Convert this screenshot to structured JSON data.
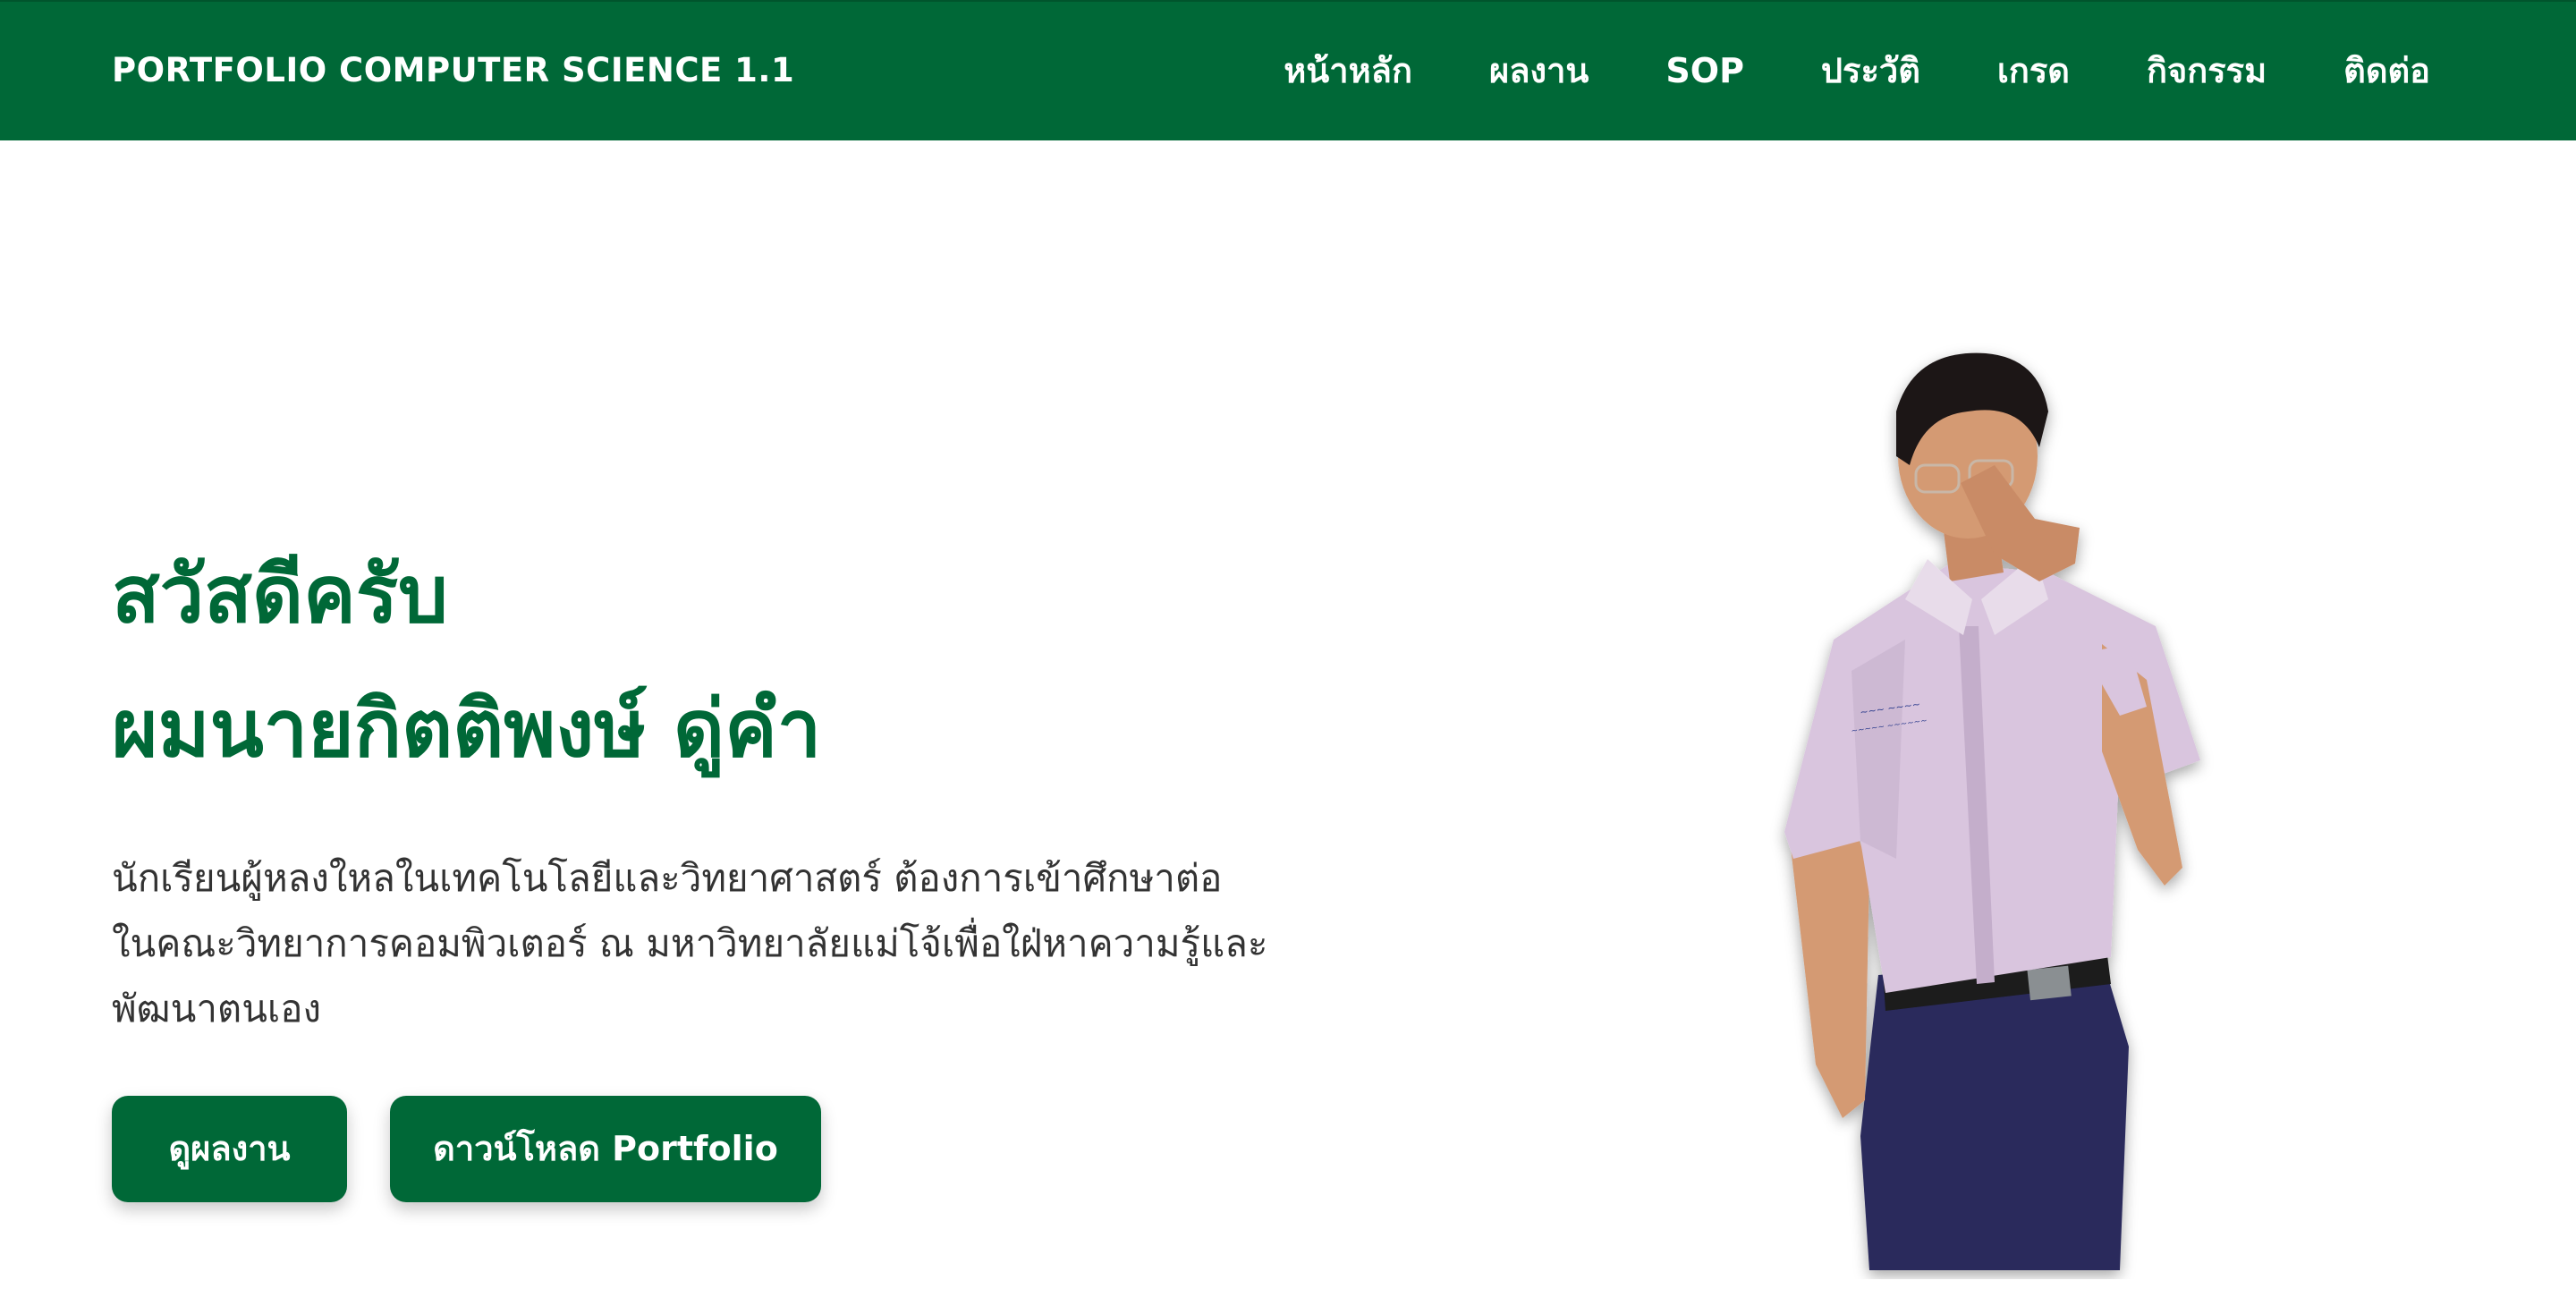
{
  "header": {
    "brand": "PORTFOLIO COMPUTER SCIENCE 1.1",
    "nav": [
      {
        "label": "หน้าหลัก"
      },
      {
        "label": "ผลงาน"
      },
      {
        "label": "SOP"
      },
      {
        "label": "ประวัติ"
      },
      {
        "label": "เกรด"
      },
      {
        "label": "กิจกรรม"
      },
      {
        "label": "ติดต่อ"
      }
    ]
  },
  "hero": {
    "greeting_line1": "สวัสดีครับ",
    "greeting_line2": "ผมนายกิตติพงษ์ ดู่คำ",
    "intro_lines": [
      "นักเรียนผู้หลงใหลในเทคโนโลยีและวิทยาศาสตร์ ต้องการเข้าศึกษาต่อ",
      "ในคณะวิทยาการคอมพิวเตอร์ ณ มหาวิทยาลัยแม่โจ้เพื่อใฝ่หาความรู้และ",
      "พัฒนาตนเอง"
    ],
    "buttons": {
      "works": "ดูผลงาน",
      "download": "ดาวน์โหลด Portfolio"
    }
  },
  "colors": {
    "primary": "#006837",
    "text": "#333333",
    "background": "#ffffff"
  }
}
